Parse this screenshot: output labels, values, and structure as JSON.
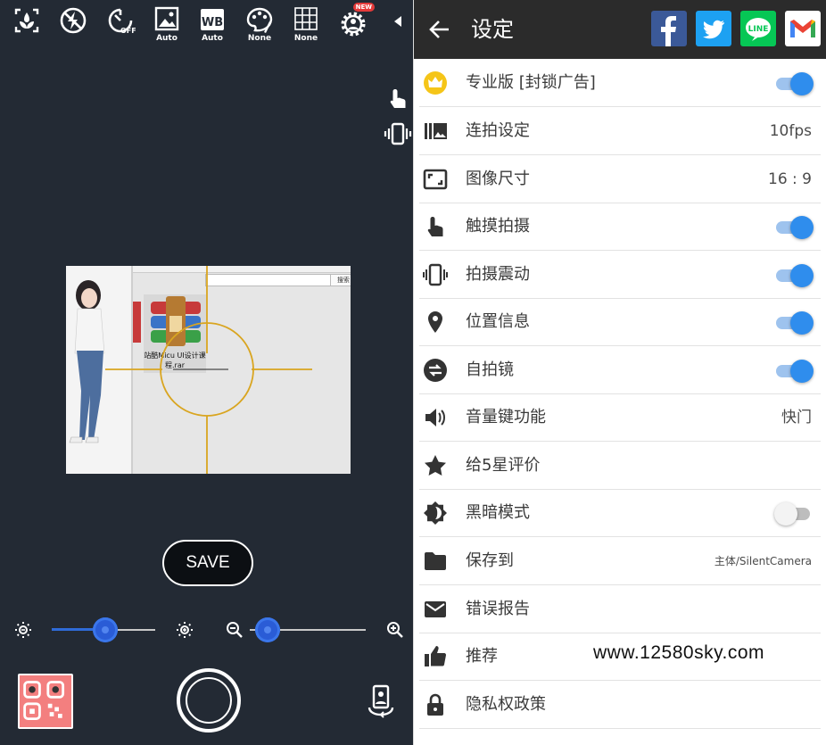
{
  "camera": {
    "toolbar": [
      {
        "icon": "macro-focus-icon",
        "caption": ""
      },
      {
        "icon": "flash-off-icon",
        "caption": ""
      },
      {
        "icon": "timer-off-icon",
        "caption": ""
      },
      {
        "icon": "scene-mode-icon",
        "caption": "Auto"
      },
      {
        "icon": "white-balance-icon",
        "caption": "Auto"
      },
      {
        "icon": "color-effect-icon",
        "caption": "None"
      },
      {
        "icon": "grid-icon",
        "caption": "None"
      },
      {
        "icon": "more-settings-gear-icon",
        "caption": "",
        "badge": "NEW"
      },
      {
        "icon": "collapse-arrow-icon",
        "caption": ""
      }
    ],
    "preview": {
      "file_label": "站酷Micu UI设计课程.rar",
      "search_button": "搜索"
    },
    "save_label": "SAVE",
    "brightness_level": 0.52,
    "zoom_level": 0.06
  },
  "settings": {
    "title": "设定",
    "share": [
      "facebook",
      "twitter",
      "line",
      "gmail"
    ],
    "rows": [
      {
        "icon": "crown-icon",
        "label": "专业版 [封锁广告]",
        "toggle": "on"
      },
      {
        "icon": "burst-icon",
        "label": "连拍设定",
        "value": "10fps"
      },
      {
        "icon": "image-size-icon",
        "label": "图像尺寸",
        "value": "16 : 9"
      },
      {
        "icon": "touch-icon",
        "label": "触摸拍摄",
        "toggle": "on"
      },
      {
        "icon": "vibrate-icon",
        "label": "拍摄震动",
        "toggle": "on"
      },
      {
        "icon": "location-icon",
        "label": "位置信息",
        "toggle": "on"
      },
      {
        "icon": "mirror-icon",
        "label": "自拍镜",
        "toggle": "on"
      },
      {
        "icon": "volume-icon",
        "label": "音量键功能",
        "value": "快门"
      },
      {
        "icon": "star-icon",
        "label": "给5星评价"
      },
      {
        "icon": "dark-mode-icon",
        "label": "黑暗模式",
        "toggle": "off"
      },
      {
        "icon": "folder-icon",
        "label": "保存到",
        "value": "主体/SilentCamera",
        "small": true
      },
      {
        "icon": "mail-icon",
        "label": "错误报告"
      },
      {
        "icon": "thumb-up-icon",
        "label": "推荐"
      },
      {
        "icon": "lock-icon",
        "label": "隐私权政策"
      }
    ],
    "watermark": "www.12580sky.com"
  },
  "colors": {
    "camera_bg": "#232a34",
    "appbar_bg": "#2b2b2b",
    "toggle_on": "#2f8ded",
    "slider_thumb": "#2a5cd6"
  }
}
